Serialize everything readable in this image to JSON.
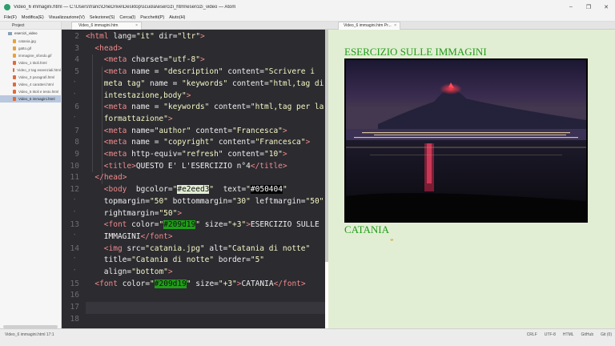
{
  "window": {
    "title": "Video_6 immagini.html — C:\\Users\\franc\\OneDrive\\Desktop\\scuola\\esercizi_html\\esercizi_video — Atom",
    "controls": [
      "–",
      "❐",
      "✕"
    ]
  },
  "menu": [
    "File(F)",
    "Modifica(E)",
    "Visualizzazione(V)",
    "Selezione(S)",
    "Cerca(I)",
    "Pacchetti(P)",
    "Aiuto(H)"
  ],
  "sidebar": {
    "tab": "Project",
    "root": "esercizi_video",
    "items": [
      {
        "label": "catania.jpg",
        "kind": "image"
      },
      {
        "label": "gatto.gif",
        "kind": "image"
      },
      {
        "label": "immagine_sfondo.gif",
        "kind": "image"
      },
      {
        "label": "Video_1 titoli.html",
        "kind": "html"
      },
      {
        "label": "Video_2 tag essenziali.html",
        "kind": "html"
      },
      {
        "label": "Video_3 paragrafi.html",
        "kind": "html"
      },
      {
        "label": "Video_4 caratteri.html",
        "kind": "html"
      },
      {
        "label": "Video_5 titoli e testo.html",
        "kind": "html"
      },
      {
        "label": "Video_6 immagini.html",
        "kind": "html",
        "selected": true
      }
    ]
  },
  "editor": {
    "tab": "Video_6 immagini.htm",
    "tab_close": "×",
    "gutter": [
      {
        "n": "2",
        "t": "ln"
      },
      {
        "n": "3",
        "t": "ln"
      },
      {
        "n": "4",
        "t": "ln"
      },
      {
        "n": "5",
        "t": "ln"
      },
      {
        "n": "•",
        "t": "bul"
      },
      {
        "n": "•",
        "t": "bul"
      },
      {
        "n": "6",
        "t": "ln"
      },
      {
        "n": "•",
        "t": "bul"
      },
      {
        "n": "7",
        "t": "ln"
      },
      {
        "n": "8",
        "t": "ln"
      },
      {
        "n": "9",
        "t": "ln"
      },
      {
        "n": "10",
        "t": "ln"
      },
      {
        "n": "11",
        "t": "ln"
      },
      {
        "n": "12",
        "t": "ln"
      },
      {
        "n": "•",
        "t": "bul"
      },
      {
        "n": "•",
        "t": "bul"
      },
      {
        "n": "13",
        "t": "ln"
      },
      {
        "n": "•",
        "t": "bul"
      },
      {
        "n": "14",
        "t": "ln"
      },
      {
        "n": "•",
        "t": "bul"
      },
      {
        "n": "•",
        "t": "bul"
      },
      {
        "n": "15",
        "t": "ln"
      },
      {
        "n": "16",
        "t": "ln"
      },
      {
        "n": "17",
        "t": "ln"
      },
      {
        "n": "18",
        "t": "ln"
      }
    ],
    "lines": [
      {
        "indent": 0,
        "parts": [
          [
            "t",
            "<html "
          ],
          [
            "a",
            "lang="
          ],
          [
            "s",
            "\"it\" "
          ],
          [
            "a",
            "dir="
          ],
          [
            "s",
            "\"ltr\""
          ],
          [
            "t",
            ">"
          ]
        ]
      },
      {
        "indent": 1,
        "parts": [
          [
            "t",
            "<head>"
          ]
        ]
      },
      {
        "indent": 2,
        "parts": [
          [
            "t",
            "<meta "
          ],
          [
            "a",
            "charset="
          ],
          [
            "s",
            "\"utf-8\""
          ],
          [
            "t",
            ">"
          ]
        ]
      },
      {
        "indent": 2,
        "parts": [
          [
            "t",
            "<meta "
          ],
          [
            "a",
            "name = "
          ],
          [
            "s",
            "\"description\" "
          ],
          [
            "a",
            "content="
          ],
          [
            "s",
            "\"Scrivere i"
          ]
        ]
      },
      {
        "indent": 2,
        "parts": [
          [
            "s",
            "meta tag\" "
          ],
          [
            "a",
            "name = "
          ],
          [
            "s",
            "\"keywords\" "
          ],
          [
            "a",
            "content="
          ],
          [
            "s",
            "\"html,tag di"
          ]
        ]
      },
      {
        "indent": 2,
        "parts": [
          [
            "s",
            "intestazione,body\""
          ],
          [
            "t",
            ">"
          ]
        ]
      },
      {
        "indent": 2,
        "parts": [
          [
            "t",
            "<meta "
          ],
          [
            "a",
            "name = "
          ],
          [
            "s",
            "\"keywords\" "
          ],
          [
            "a",
            "content="
          ],
          [
            "s",
            "\"html,tag per la"
          ]
        ]
      },
      {
        "indent": 2,
        "parts": [
          [
            "s",
            "formattazione\""
          ],
          [
            "t",
            ">"
          ]
        ]
      },
      {
        "indent": 2,
        "parts": [
          [
            "t",
            "<meta "
          ],
          [
            "a",
            "name="
          ],
          [
            "s",
            "\"author\" "
          ],
          [
            "a",
            "content="
          ],
          [
            "s",
            "\"Francesca\""
          ],
          [
            "t",
            ">"
          ]
        ]
      },
      {
        "indent": 2,
        "parts": [
          [
            "t",
            "<meta "
          ],
          [
            "a",
            "name = "
          ],
          [
            "s",
            "\"copyright\" "
          ],
          [
            "a",
            "content="
          ],
          [
            "s",
            "\"Francesca\""
          ],
          [
            "t",
            ">"
          ]
        ]
      },
      {
        "indent": 2,
        "parts": [
          [
            "t",
            "<meta "
          ],
          [
            "a",
            "http-equiv="
          ],
          [
            "s",
            "\"refresh\" "
          ],
          [
            "a",
            "content="
          ],
          [
            "s",
            "\"10\""
          ],
          [
            "t",
            ">"
          ]
        ]
      },
      {
        "indent": 2,
        "parts": [
          [
            "t",
            "<title>"
          ],
          [
            "a",
            "QUESTO E' L'ESERCIZIO n°4"
          ],
          [
            "t",
            "</title>"
          ]
        ]
      },
      {
        "indent": 1,
        "parts": [
          [
            "t",
            "</head>"
          ]
        ]
      },
      {
        "indent": 2,
        "parts": [
          [
            "t",
            "<body  "
          ],
          [
            "a",
            "bgcolor="
          ],
          [
            "s",
            "\""
          ],
          [
            "hl1",
            "#e2eed3"
          ],
          [
            "s",
            "\"  "
          ],
          [
            "a",
            "text="
          ],
          [
            "s",
            "\""
          ],
          [
            "hl2",
            "#050404"
          ],
          [
            "s",
            "\""
          ]
        ]
      },
      {
        "indent": 2,
        "parts": [
          [
            "a",
            "topmargin="
          ],
          [
            "s",
            "\"50\" "
          ],
          [
            "a",
            "bottommargin="
          ],
          [
            "s",
            "\"30\" "
          ],
          [
            "a",
            "leftmargin="
          ],
          [
            "s",
            "\"50\""
          ]
        ]
      },
      {
        "indent": 2,
        "parts": [
          [
            "a",
            "rightmargin="
          ],
          [
            "s",
            "\"50\""
          ],
          [
            "t",
            ">"
          ]
        ]
      },
      {
        "indent": 2,
        "parts": [
          [
            "t",
            "<font "
          ],
          [
            "a",
            "color="
          ],
          [
            "s",
            "\""
          ],
          [
            "hl3",
            "#209d19"
          ],
          [
            "s",
            "\" "
          ],
          [
            "a",
            "size="
          ],
          [
            "s",
            "\"+3\""
          ],
          [
            "t",
            ">"
          ],
          [
            "a",
            "ESERCIZIO SULLE"
          ]
        ]
      },
      {
        "indent": 2,
        "parts": [
          [
            "a",
            "IMMAGINI"
          ],
          [
            "t",
            "</font>"
          ]
        ]
      },
      {
        "indent": 2,
        "parts": [
          [
            "t",
            "<img "
          ],
          [
            "a",
            "src="
          ],
          [
            "s",
            "\"catania.jpg\" "
          ],
          [
            "a",
            "alt="
          ],
          [
            "s",
            "\"Catania di notte\""
          ]
        ]
      },
      {
        "indent": 2,
        "parts": [
          [
            "a",
            "title="
          ],
          [
            "s",
            "\"Catania di notte\" "
          ],
          [
            "a",
            "border="
          ],
          [
            "s",
            "\"5\""
          ]
        ]
      },
      {
        "indent": 2,
        "parts": [
          [
            "a",
            "align="
          ],
          [
            "s",
            "\"bottom\""
          ],
          [
            "t",
            ">"
          ]
        ]
      },
      {
        "indent": 1,
        "parts": [
          [
            "t",
            "<font "
          ],
          [
            "a",
            "color="
          ],
          [
            "s",
            "\""
          ],
          [
            "hl3",
            "#209d19"
          ],
          [
            "s",
            "\" "
          ],
          [
            "a",
            "size="
          ],
          [
            "s",
            "\"+3\""
          ],
          [
            "t",
            ">"
          ],
          [
            "a",
            "CATANIA"
          ],
          [
            "t",
            "</font>"
          ]
        ]
      },
      {
        "indent": 0,
        "parts": []
      },
      {
        "indent": 0,
        "parts": []
      },
      {
        "indent": 0,
        "parts": []
      }
    ],
    "cursor_row": 23
  },
  "preview": {
    "tab": "Video_6 immagini.htm Pr...",
    "tab_close": "×",
    "heading": "ESERCIZIO SULLE IMMAGINI",
    "caption": "CATANIA",
    "cursor_glyph": "⌖",
    "bgcolor": "#e2eed3",
    "text_color": "#050404",
    "font_color": "#209d19"
  },
  "status": {
    "left": "Video_6 immagini.html  17:1",
    "right": [
      "CRLF",
      "UTF-8",
      "HTML",
      "GitHub",
      "Git (0)"
    ]
  },
  "colors": {
    "editor_bg": "#2b2b30",
    "tag": "#f18b8b",
    "string": "#f7f7c6"
  }
}
